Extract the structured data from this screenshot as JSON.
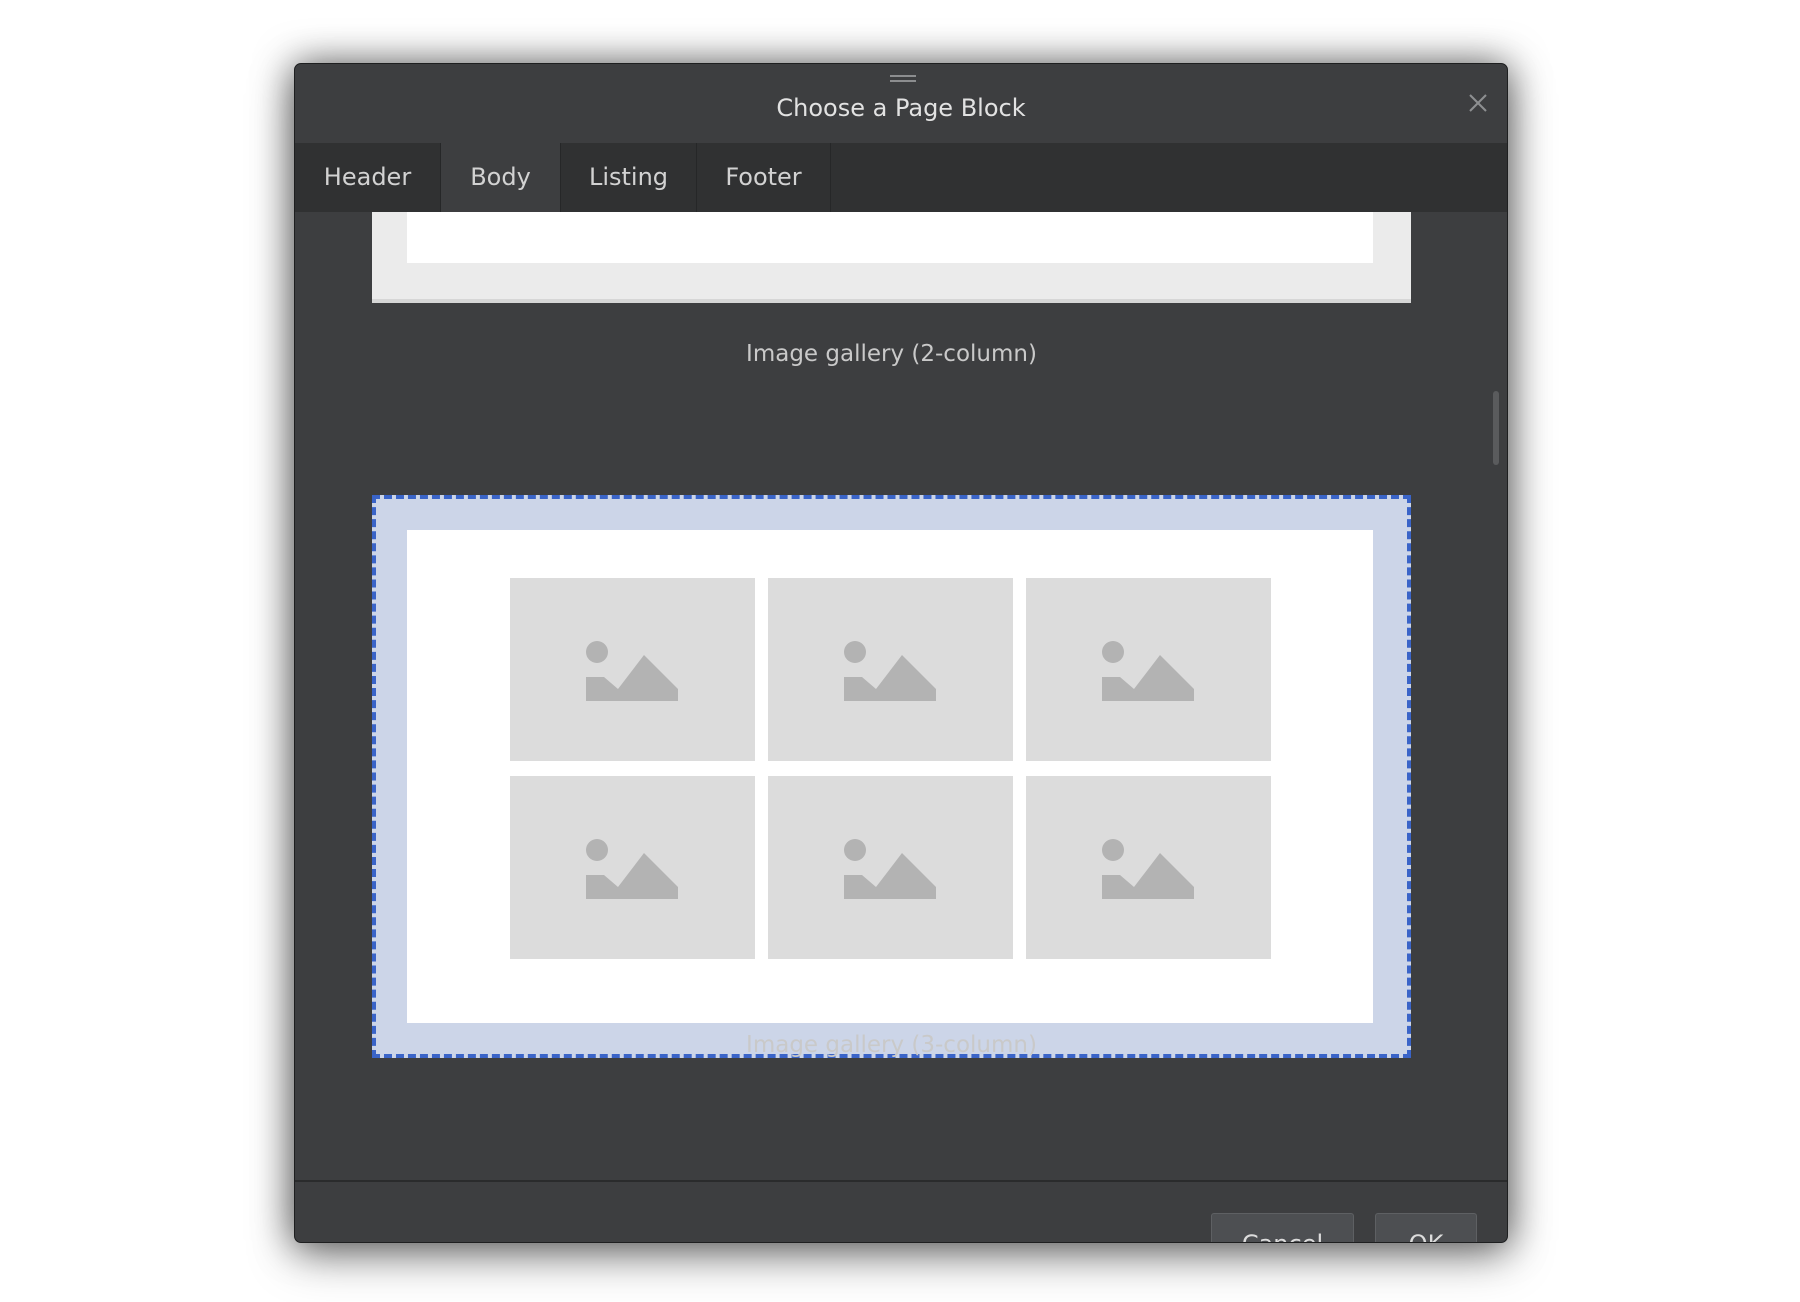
{
  "dialog": {
    "title": "Choose a Page Block",
    "close_icon": "close-icon"
  },
  "tabs": [
    {
      "label": "Header",
      "active": false
    },
    {
      "label": "Body",
      "active": true
    },
    {
      "label": "Listing",
      "active": false
    },
    {
      "label": "Footer",
      "active": false
    }
  ],
  "blocks": [
    {
      "caption": "Image gallery (2-column)",
      "selected": false
    },
    {
      "caption": "Image gallery (3-column)",
      "selected": true
    }
  ],
  "buttons": {
    "cancel": "Cancel",
    "ok": "OK"
  },
  "colors": {
    "dialog_bg": "#3d3e40",
    "tabbar_bg": "#303132",
    "selection_border": "#3a64c8",
    "selection_fill": "#ccd5e8",
    "placeholder": "#dcdcdc",
    "placeholder_icon": "#b3b3b3"
  }
}
